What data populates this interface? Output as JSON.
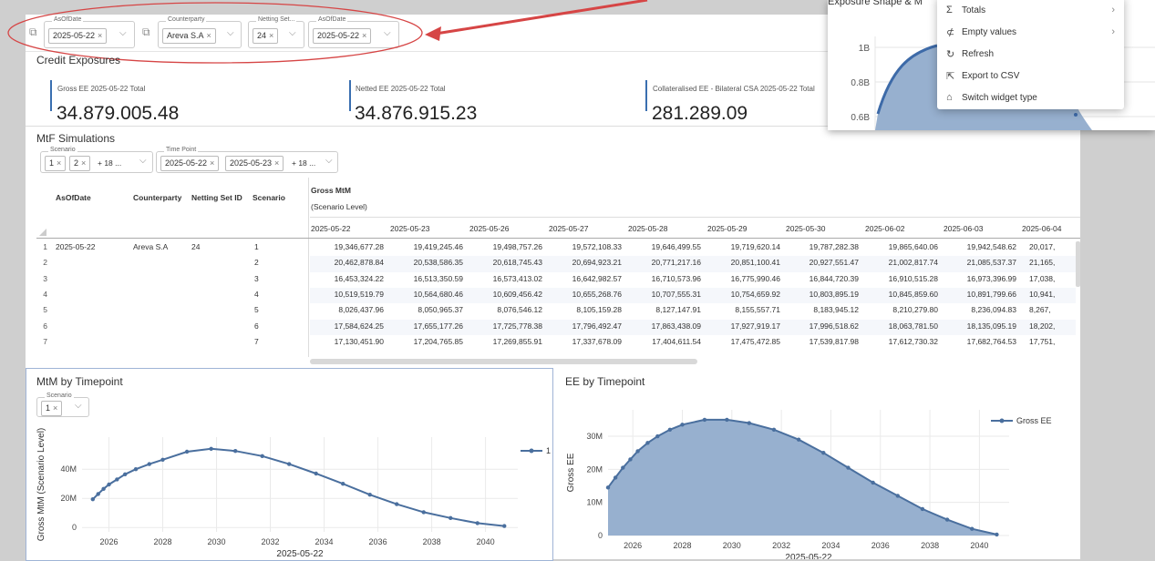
{
  "filters": {
    "group1": {
      "label": "AsOfDate",
      "value": "2025-05-22"
    },
    "group2": {
      "counterparty": {
        "label": "Counterparty",
        "value": "Areva S.A"
      },
      "netting": {
        "label": "Netting Set...",
        "value": "24"
      },
      "asofdate": {
        "label": "AsOfDate",
        "value": "2025-05-22"
      }
    }
  },
  "credit_exposures": {
    "title": "Credit Exposures",
    "kpis": [
      {
        "label": "Gross EE 2025-05-22 Total",
        "value": "34.879.005.48"
      },
      {
        "label": "Netted EE 2025-05-22 Total",
        "value": "34.876.915.23"
      },
      {
        "label": "Collateralised EE - Bilateral CSA 2025-05-22 Total",
        "value": "281.289.09"
      }
    ]
  },
  "mtf": {
    "title": "MtF Simulations",
    "scenario_filter": {
      "label": "Scenario",
      "chips": [
        "1",
        "2"
      ],
      "more": "+ 18 ..."
    },
    "timepoint_filter": {
      "label": "Time Point",
      "chips": [
        "2025-05-22",
        "2025-05-23"
      ],
      "more": "+ 18 ..."
    },
    "headers": {
      "asofdate": "AsOfDate",
      "counterparty": "Counterparty",
      "netting": "Netting Set ID",
      "scenario": "Scenario",
      "gross_mtm": "Gross MtM",
      "scenario_level": "(Scenario Level)"
    },
    "dates": [
      "2025-05-22",
      "2025-05-23",
      "2025-05-26",
      "2025-05-27",
      "2025-05-28",
      "2025-05-29",
      "2025-05-30",
      "2025-06-02",
      "2025-06-03",
      "2025-06-04"
    ],
    "first_row": {
      "asofdate": "2025-05-22",
      "counterparty": "Areva S.A",
      "netting": "24"
    },
    "rows": [
      {
        "n": "1",
        "scenario": "1",
        "values": [
          "19,346,677.28",
          "19,419,245.46",
          "19,498,757.26",
          "19,572,108.33",
          "19,646,499.55",
          "19,719,620.14",
          "19,787,282.38",
          "19,865,640.06",
          "19,942,548.62",
          "20,017,"
        ]
      },
      {
        "n": "2",
        "scenario": "2",
        "values": [
          "20,462,878.84",
          "20,538,586.35",
          "20,618,745.43",
          "20,694,923.21",
          "20,771,217.16",
          "20,851,100.41",
          "20,927,551.47",
          "21,002,817.74",
          "21,085,537.37",
          "21,165,"
        ]
      },
      {
        "n": "3",
        "scenario": "3",
        "values": [
          "16,453,324.22",
          "16,513,350.59",
          "16,573,413.02",
          "16,642,982.57",
          "16,710,573.96",
          "16,775,990.46",
          "16,844,720.39",
          "16,910,515.28",
          "16,973,396.99",
          "17,038,"
        ]
      },
      {
        "n": "4",
        "scenario": "4",
        "values": [
          "10,519,519.79",
          "10,564,680.46",
          "10,609,456.42",
          "10,655,268.76",
          "10,707,555.31",
          "10,754,659.92",
          "10,803,895.19",
          "10,845,859.60",
          "10,891,799.66",
          "10,941,"
        ]
      },
      {
        "n": "5",
        "scenario": "5",
        "values": [
          "8,026,437.96",
          "8,050,965.37",
          "8,076,546.12",
          "8,105,159.28",
          "8,127,147.91",
          "8,155,557.71",
          "8,183,945.12",
          "8,210,279.80",
          "8,236,094.83",
          "8,267,"
        ]
      },
      {
        "n": "6",
        "scenario": "6",
        "values": [
          "17,584,624.25",
          "17,655,177.26",
          "17,725,778.38",
          "17,796,492.47",
          "17,863,438.09",
          "17,927,919.17",
          "17,996,518.62",
          "18,063,781.50",
          "18,135,095.19",
          "18,202,"
        ]
      },
      {
        "n": "7",
        "scenario": "7",
        "values": [
          "17,130,451.90",
          "17,204,765.85",
          "17,269,855.91",
          "17,337,678.09",
          "17,404,611.54",
          "17,475,472.85",
          "17,539,817.98",
          "17,612,730.32",
          "17,682,764.53",
          "17,751,"
        ]
      }
    ]
  },
  "mtm_chart": {
    "title": "MtM by Timepoint",
    "scenario_filter": {
      "label": "Scenario",
      "chip": "1"
    },
    "ylabel": "Gross MtM (Scenario Level)",
    "xlabel": "2025-05-22",
    "legend": "1"
  },
  "ee_chart": {
    "title": "EE by Timepoint",
    "ylabel": "Gross EE",
    "xlabel": "2025-05-22",
    "legend": "Gross EE"
  },
  "popup": {
    "title": "Exposure Shape & M",
    "yticks": [
      "1B",
      "0.8B",
      "0.6B"
    ],
    "menu": [
      {
        "icon": "Σ",
        "label": "Totals",
        "arrow": "›"
      },
      {
        "icon": "⊄",
        "label": "Empty values",
        "arrow": "›"
      },
      {
        "icon": "↻",
        "label": "Refresh",
        "arrow": ""
      },
      {
        "icon": "⇱",
        "label": "Export to CSV",
        "arrow": ""
      },
      {
        "icon": "⌂",
        "label": "Switch widget type",
        "arrow": ""
      }
    ]
  },
  "chart_data": [
    {
      "type": "line",
      "title": "MtM by Timepoint",
      "xlabel": "2025-05-22",
      "ylabel": "Gross MtM (Scenario Level)",
      "xticks": [
        "2026",
        "2028",
        "2030",
        "2032",
        "2034",
        "2036",
        "2038",
        "2040"
      ],
      "yticks": [
        "0",
        "20M",
        "40M"
      ],
      "xlim": [
        2025,
        2041.2
      ],
      "ylim": [
        -3000000,
        62000000
      ],
      "series": [
        {
          "name": "1",
          "x": [
            2025.4,
            2025.6,
            2025.8,
            2026.0,
            2026.3,
            2026.6,
            2027.0,
            2027.5,
            2028.0,
            2028.9,
            2029.8,
            2030.7,
            2031.7,
            2032.7,
            2033.7,
            2034.7,
            2035.7,
            2036.7,
            2037.7,
            2038.7,
            2039.7,
            2040.7
          ],
          "y": [
            19400000,
            23000000,
            26500000,
            29500000,
            33000000,
            36500000,
            40000000,
            43500000,
            46500000,
            52000000,
            54000000,
            52500000,
            49000000,
            43500000,
            37000000,
            30000000,
            22500000,
            16000000,
            10500000,
            6500000,
            3000000,
            1000000
          ]
        }
      ],
      "legend": "right",
      "grid": true,
      "colors": [
        "#4a6f9e"
      ]
    },
    {
      "type": "area",
      "title": "EE by Timepoint",
      "xlabel": "2025-05-22",
      "ylabel": "Gross EE",
      "xticks": [
        "2026",
        "2028",
        "2030",
        "2032",
        "2034",
        "2036",
        "2038",
        "2040"
      ],
      "yticks": [
        "0",
        "10M",
        "20M",
        "30M"
      ],
      "xlim": [
        2025,
        2041.2
      ],
      "ylim": [
        0,
        38000000
      ],
      "series": [
        {
          "name": "Gross EE",
          "x": [
            2025.0,
            2025.3,
            2025.6,
            2025.9,
            2026.2,
            2026.6,
            2027.0,
            2027.5,
            2028.0,
            2028.9,
            2029.8,
            2030.7,
            2031.7,
            2032.7,
            2033.7,
            2034.7,
            2035.7,
            2036.7,
            2037.7,
            2038.7,
            2039.7,
            2040.7
          ],
          "y": [
            14500000,
            17500000,
            20500000,
            23000000,
            25500000,
            28000000,
            30000000,
            32000000,
            33500000,
            35000000,
            35000000,
            34000000,
            32000000,
            29000000,
            25000000,
            20500000,
            16000000,
            12000000,
            8000000,
            4800000,
            2000000,
            300000
          ]
        }
      ],
      "legend": "top-right",
      "grid": true,
      "colors": [
        "#4a6f9e",
        "#97b0cf"
      ]
    }
  ]
}
